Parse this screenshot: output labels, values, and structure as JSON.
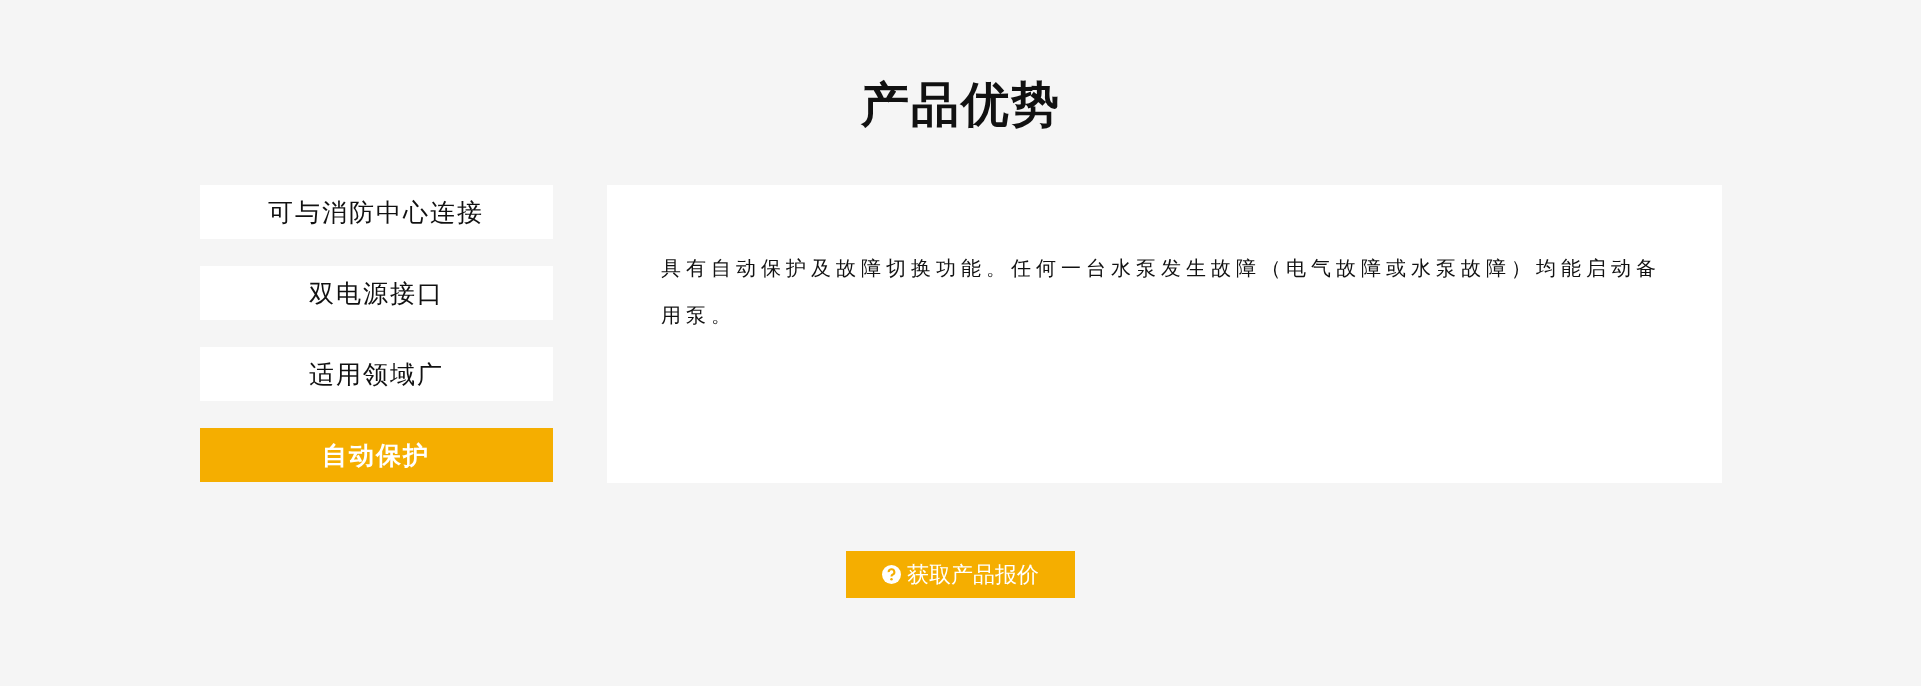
{
  "title": "产品优势",
  "tabs": [
    {
      "label": "可与消防中心连接",
      "selected": false
    },
    {
      "label": "双电源接口",
      "selected": false
    },
    {
      "label": "适用领域广",
      "selected": false
    },
    {
      "label": "自动保护",
      "selected": true
    }
  ],
  "content": {
    "text": "具有自动保护及故障切换功能。任何一台水泵发生故障（电气故障或水泵故障）均能启动备用泵。"
  },
  "quote_button": {
    "label": "获取产品报价"
  }
}
